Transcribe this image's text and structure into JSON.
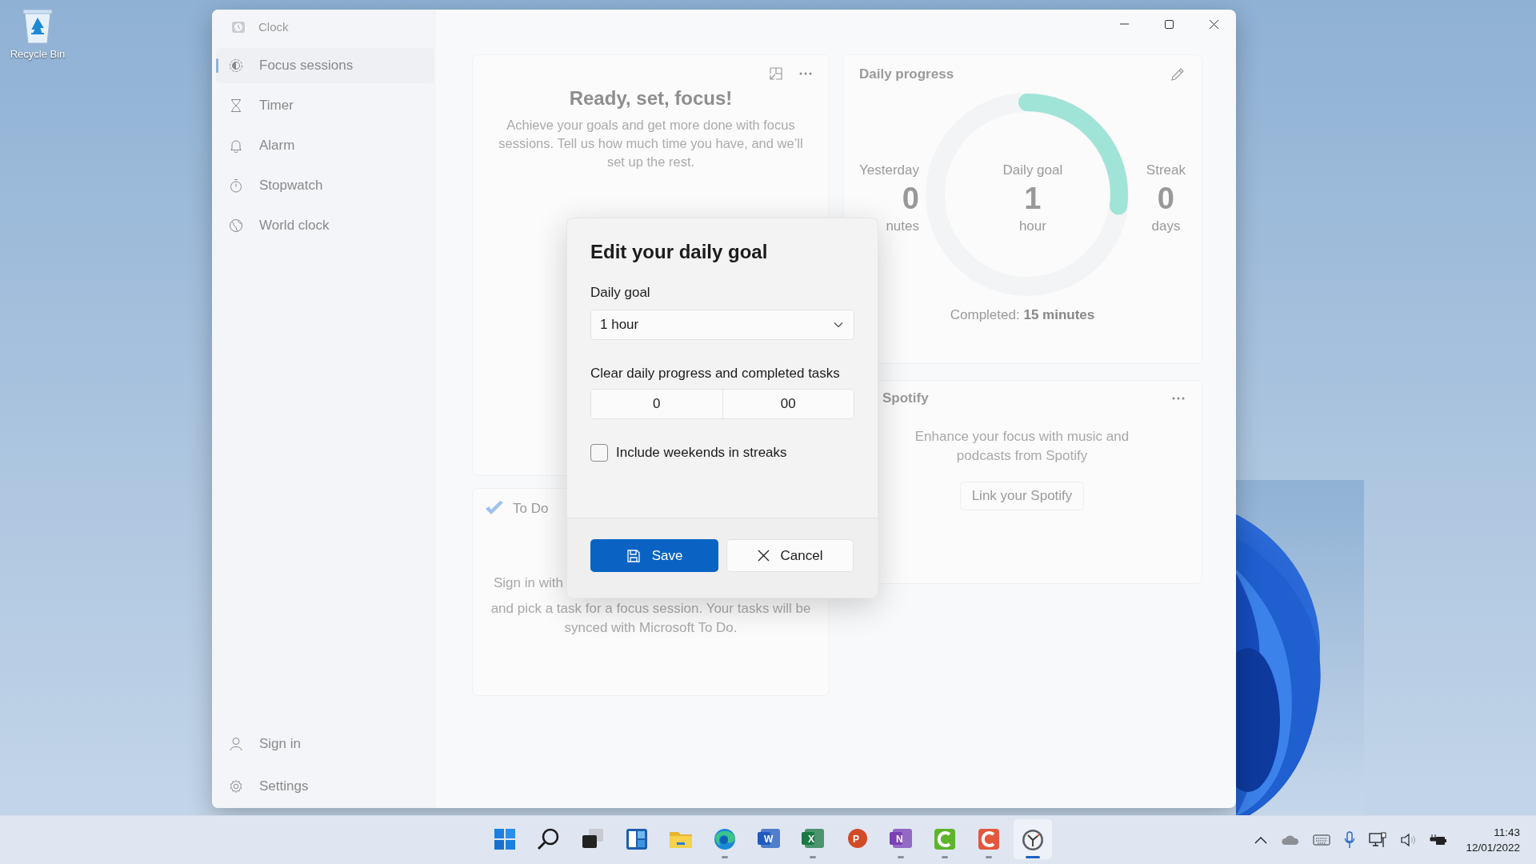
{
  "desktop": {
    "recycle_bin": "Recycle Bin"
  },
  "window": {
    "title": "Clock"
  },
  "sidebar": {
    "items": [
      {
        "label": "Focus sessions",
        "selected": true
      },
      {
        "label": "Timer",
        "selected": false
      },
      {
        "label": "Alarm",
        "selected": false
      },
      {
        "label": "Stopwatch",
        "selected": false
      },
      {
        "label": "World clock",
        "selected": false
      }
    ],
    "footer": [
      {
        "label": "Sign in"
      },
      {
        "label": "Settings"
      }
    ]
  },
  "focus_card": {
    "title": "Ready, set, focus!",
    "text": "Achieve your goals and get more done with focus sessions. Tell us how much time you have, and we’ll set up the rest."
  },
  "todo_card": {
    "title": "To Do",
    "lines": [
      "Sign in with",
      "and pick a task for a focus session. Your tasks will be",
      "synced with Microsoft To Do."
    ]
  },
  "progress_card": {
    "title": "Daily progress",
    "ring": {
      "level": 0.27
    },
    "stats": [
      {
        "label": "Yesterday",
        "value": "0",
        "unit": "nutes"
      },
      {
        "label": "Daily goal",
        "value": "1",
        "unit": "hour"
      },
      {
        "label": "Streak",
        "value": "0",
        "unit": "days"
      }
    ],
    "completed": "Completed: **15 minutes**"
  },
  "spotify_card": {
    "title": "Spotify",
    "text": "Enhance your focus with music and podcasts from Spotify",
    "button": "Link your Spotify"
  },
  "dialog": {
    "title": "Edit your daily goal",
    "goal_label": "Daily goal",
    "goal_value": "1 hour",
    "clear_label": "Clear daily progress and completed tasks",
    "clear_fields": [
      "0",
      "00"
    ],
    "weekends": {
      "label": "Include weekends in streaks",
      "checked": false
    },
    "save": "Save",
    "cancel": "Cancel"
  },
  "taskbar": {
    "apps": [
      {
        "running": false,
        "selected": false
      },
      {
        "running": false,
        "selected": false
      },
      {
        "running": false,
        "selected": false
      },
      {
        "running": false,
        "selected": false
      },
      {
        "running": false,
        "selected": false
      },
      {
        "running": true,
        "selected": false
      },
      {
        "running": false,
        "selected": false,
        "glyph": "W"
      },
      {
        "running": true,
        "selected": false,
        "glyph": "X"
      },
      {
        "running": false,
        "selected": false,
        "glyph": "P"
      },
      {
        "running": true,
        "selected": false,
        "glyph": "N"
      },
      {
        "running": true,
        "selected": false
      },
      {
        "running": true,
        "selected": false
      },
      {
        "running": true,
        "selected": true
      }
    ]
  },
  "tray": {
    "time": "11:43",
    "date": "12/01/2022"
  }
}
